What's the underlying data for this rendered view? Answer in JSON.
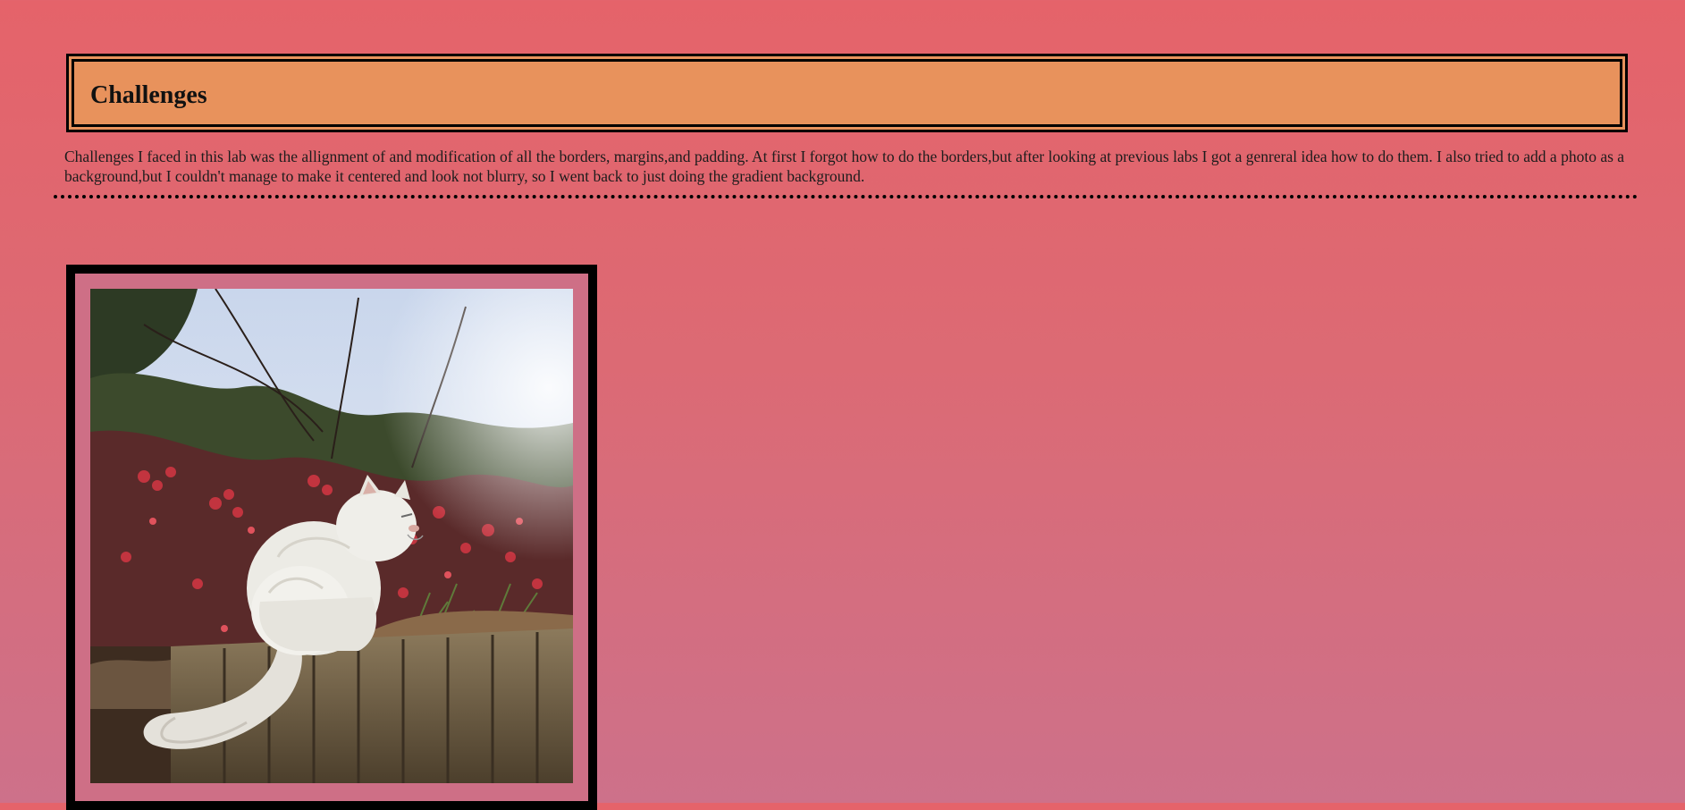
{
  "header": {
    "title": "Challenges"
  },
  "content": {
    "paragraph": "Challenges I faced in this lab was the allignment of and modification of all the borders, margins,and padding. At first I forgot how to do the borders,but after looking at previous labs I got a genreral idea how to do them. I also tried to add a photo as a background,but I couldn't manage to make it centered and look not blurry, so I went back to just doing the gradient background."
  },
  "colors": {
    "background_top": "#e5636a",
    "background_bottom": "#cd718a",
    "header_fill": "#e8925c",
    "border": "#000000"
  },
  "image": {
    "subject": "white-cat-on-wall-photo"
  }
}
